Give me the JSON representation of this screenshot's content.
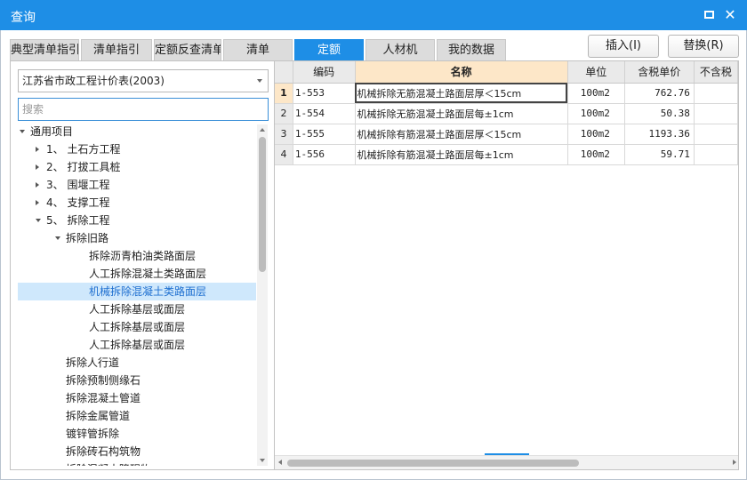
{
  "window": {
    "title": "查询"
  },
  "colors": {
    "accent": "#1e8ee6",
    "selected_row": "#cfe8fc",
    "header_highlight": "#fde7c8"
  },
  "tabs": [
    {
      "label": "典型清单指引"
    },
    {
      "label": "清单指引"
    },
    {
      "label": "定额反查清单"
    },
    {
      "label": "清单"
    },
    {
      "label": "定额"
    },
    {
      "label": "人材机"
    },
    {
      "label": "我的数据"
    }
  ],
  "actions": {
    "insert": "插入(I)",
    "replace": "替换(R)"
  },
  "left": {
    "selected_library": "江苏省市政工程计价表(2003)",
    "search_placeholder": "搜索",
    "tree": [
      {
        "label": "通用项目",
        "expander": "down",
        "indent": 0
      },
      {
        "label": "1、 土石方工程",
        "expander": "right",
        "indent": 1
      },
      {
        "label": "2、 打拔工具桩",
        "expander": "right",
        "indent": 1
      },
      {
        "label": "3、 围堰工程",
        "expander": "right",
        "indent": 1
      },
      {
        "label": "4、 支撑工程",
        "expander": "right",
        "indent": 1
      },
      {
        "label": "5、 拆除工程",
        "expander": "down",
        "indent": 1
      },
      {
        "label": "拆除旧路",
        "expander": "down",
        "indent": 2
      },
      {
        "label": "拆除沥青柏油类路面层",
        "expander": "",
        "indent": 3
      },
      {
        "label": "人工拆除混凝土类路面层",
        "expander": "",
        "indent": 3
      },
      {
        "label": "机械拆除混凝土类路面层",
        "expander": "",
        "indent": 3,
        "selected": true
      },
      {
        "label": "人工拆除基层或面层",
        "expander": "",
        "indent": 3
      },
      {
        "label": "人工拆除基层或面层",
        "expander": "",
        "indent": 3
      },
      {
        "label": "人工拆除基层或面层",
        "expander": "",
        "indent": 3
      },
      {
        "label": "拆除人行道",
        "expander": "",
        "indent": 2
      },
      {
        "label": "拆除预制侧缘石",
        "expander": "",
        "indent": 2
      },
      {
        "label": "拆除混凝土管道",
        "expander": "",
        "indent": 2
      },
      {
        "label": "拆除金属管道",
        "expander": "",
        "indent": 2
      },
      {
        "label": "镀锌管拆除",
        "expander": "",
        "indent": 2
      },
      {
        "label": "拆除砖石构筑物",
        "expander": "",
        "indent": 2
      },
      {
        "label": "拆除混凝土障碍物",
        "expander": "",
        "indent": 2
      }
    ]
  },
  "table": {
    "columns": [
      "",
      "编码",
      "名称",
      "单位",
      "含税单价",
      "不含税"
    ],
    "rows": [
      {
        "num": "1",
        "code": "1-553",
        "name": "机械拆除无筋混凝土路面层厚＜15cm",
        "unit": "100m2",
        "price": "762.76"
      },
      {
        "num": "2",
        "code": "1-554",
        "name": "机械拆除无筋混凝土路面层每±1cm",
        "unit": "100m2",
        "price": "50.38"
      },
      {
        "num": "3",
        "code": "1-555",
        "name": "机械拆除有筋混凝土路面层厚＜15cm",
        "unit": "100m2",
        "price": "1193.36"
      },
      {
        "num": "4",
        "code": "1-556",
        "name": "机械拆除有筋混凝土路面层每±1cm",
        "unit": "100m2",
        "price": "59.71"
      }
    ]
  }
}
